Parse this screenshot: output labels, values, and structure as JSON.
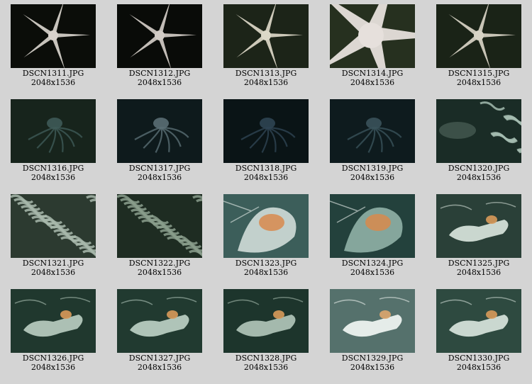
{
  "gallery": {
    "items": [
      {
        "filename": "DSCN1311.JPG",
        "dimensions": "2048x1536",
        "scene": "seastar",
        "bg": "#0b0d09",
        "subject": "#d8d2cc"
      },
      {
        "filename": "DSCN1312.JPG",
        "dimensions": "2048x1536",
        "scene": "seastar",
        "bg": "#090b08",
        "subject": "#d2ccc6"
      },
      {
        "filename": "DSCN1313.JPG",
        "dimensions": "2048x1536",
        "scene": "seastar",
        "bg": "#1c2418",
        "subject": "#dcd8c8"
      },
      {
        "filename": "DSCN1314.JPG",
        "dimensions": "2048x1536",
        "scene": "seastar-close",
        "bg": "#26301f",
        "subject": "#e6e0dc"
      },
      {
        "filename": "DSCN1315.JPG",
        "dimensions": "2048x1536",
        "scene": "seastar",
        "bg": "#1a2317",
        "subject": "#d8d4c6"
      },
      {
        "filename": "DSCN1316.JPG",
        "dimensions": "2048x1536",
        "scene": "octopus",
        "bg": "#17241c",
        "subject": "#3e5a58"
      },
      {
        "filename": "DSCN1317.JPG",
        "dimensions": "2048x1536",
        "scene": "octopus",
        "bg": "#0e1a1c",
        "subject": "#5a6e74"
      },
      {
        "filename": "DSCN1318.JPG",
        "dimensions": "2048x1536",
        "scene": "octopus",
        "bg": "#0a1416",
        "subject": "#2e4452"
      },
      {
        "filename": "DSCN1319.JPG",
        "dimensions": "2048x1536",
        "scene": "octopus",
        "bg": "#0e1b1e",
        "subject": "#3a525a"
      },
      {
        "filename": "DSCN1320.JPG",
        "dimensions": "2048x1536",
        "scene": "tubeworms",
        "bg": "#1a2c26",
        "subject": "#a4bcb0"
      },
      {
        "filename": "DSCN1321.JPG",
        "dimensions": "2048x1536",
        "scene": "tubeworms-dense",
        "bg": "#2c3a30",
        "subject": "#a8b8ac"
      },
      {
        "filename": "DSCN1322.JPG",
        "dimensions": "2048x1536",
        "scene": "tubeworms-dense",
        "bg": "#1e2c22",
        "subject": "#8a9e8c"
      },
      {
        "filename": "DSCN1323.JPG",
        "dimensions": "2048x1536",
        "scene": "bacterial-mat",
        "bg": "#3c5e5a",
        "subject": "#e4ece8"
      },
      {
        "filename": "DSCN1324.JPG",
        "dimensions": "2048x1536",
        "scene": "bacterial-mat",
        "bg": "#23413c",
        "subject": "#9ebfb4"
      },
      {
        "filename": "DSCN1325.JPG",
        "dimensions": "2048x1536",
        "scene": "debris",
        "bg": "#2a4038",
        "subject": "#d8e4dc"
      },
      {
        "filename": "DSCN1326.JPG",
        "dimensions": "2048x1536",
        "scene": "debris",
        "bg": "#20382e",
        "subject": "#b8ccc0"
      },
      {
        "filename": "DSCN1327.JPG",
        "dimensions": "2048x1536",
        "scene": "debris",
        "bg": "#213a30",
        "subject": "#bcd0c4"
      },
      {
        "filename": "DSCN1328.JPG",
        "dimensions": "2048x1536",
        "scene": "debris",
        "bg": "#1d352c",
        "subject": "#b0c4b8"
      },
      {
        "filename": "DSCN1329.JPG",
        "dimensions": "2048x1536",
        "scene": "debris-bright",
        "bg": "#3e5e58",
        "subject": "#f0f6f2"
      },
      {
        "filename": "DSCN1330.JPG",
        "dimensions": "2048x1536",
        "scene": "debris",
        "bg": "#2e4a40",
        "subject": "#d8e4dc"
      }
    ]
  }
}
